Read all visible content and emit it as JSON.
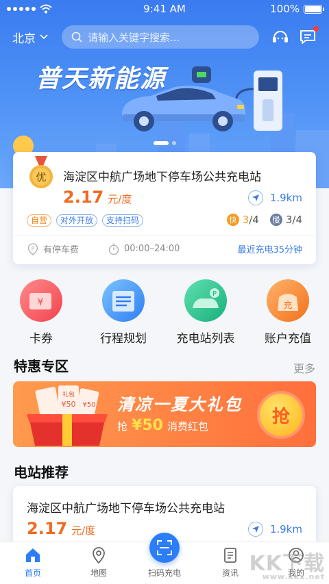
{
  "status_bar": {
    "time": "9:41 AM",
    "battery": "100%"
  },
  "header": {
    "city": "北京",
    "search_placeholder": "请输入关键字搜索..."
  },
  "banner": {
    "title": "普天新能源"
  },
  "nearest_station": {
    "badge": "优",
    "name": "海淀区中航广场地下停车场公共充电站",
    "price": "2.17",
    "price_unit": "元/度",
    "distance": "1.9km",
    "tags": [
      "自营",
      "对外开放",
      "支持扫码"
    ],
    "fast_label": "快",
    "fast_available": "3",
    "fast_total": "/4",
    "slow_label": "慢",
    "slow_available": "3",
    "slow_total": "/4",
    "parking": "有停车费",
    "hours": "00:00–24:00",
    "recent": "最近充电35分钟"
  },
  "quick_menu": [
    {
      "label": "卡券",
      "icon": "coupon-icon"
    },
    {
      "label": "行程规划",
      "icon": "route-plan-icon"
    },
    {
      "label": "充电站列表",
      "icon": "station-list-icon"
    },
    {
      "label": "账户充值",
      "icon": "wallet-recharge-icon"
    }
  ],
  "specials": {
    "title": "特惠专区",
    "more": "更多",
    "promo": {
      "title": "清凉一夏大礼包",
      "prefix": "抢",
      "amount": "¥50",
      "suffix": "消费红包",
      "button": "抢",
      "ticket1": "¥50",
      "ticket2": "¥50",
      "ticket_label": "礼包"
    }
  },
  "recommend": {
    "title": "电站推荐",
    "station": {
      "name": "海淀区中航广场地下停车场公共充电站",
      "price": "2.17",
      "price_unit": "元/度",
      "distance": "1.9km"
    }
  },
  "tabbar": [
    {
      "label": "首页",
      "active": true
    },
    {
      "label": "地图",
      "active": false
    },
    {
      "label": "扫码充电",
      "active": false
    },
    {
      "label": "资讯",
      "active": false
    },
    {
      "label": "我的",
      "active": false
    }
  ],
  "watermark": {
    "text": "KK下载",
    "url": "www.kkx.net"
  },
  "colors": {
    "primary": "#2c7ef8",
    "accent_orange": "#f06a1f",
    "banner": "#3a7bf0"
  }
}
